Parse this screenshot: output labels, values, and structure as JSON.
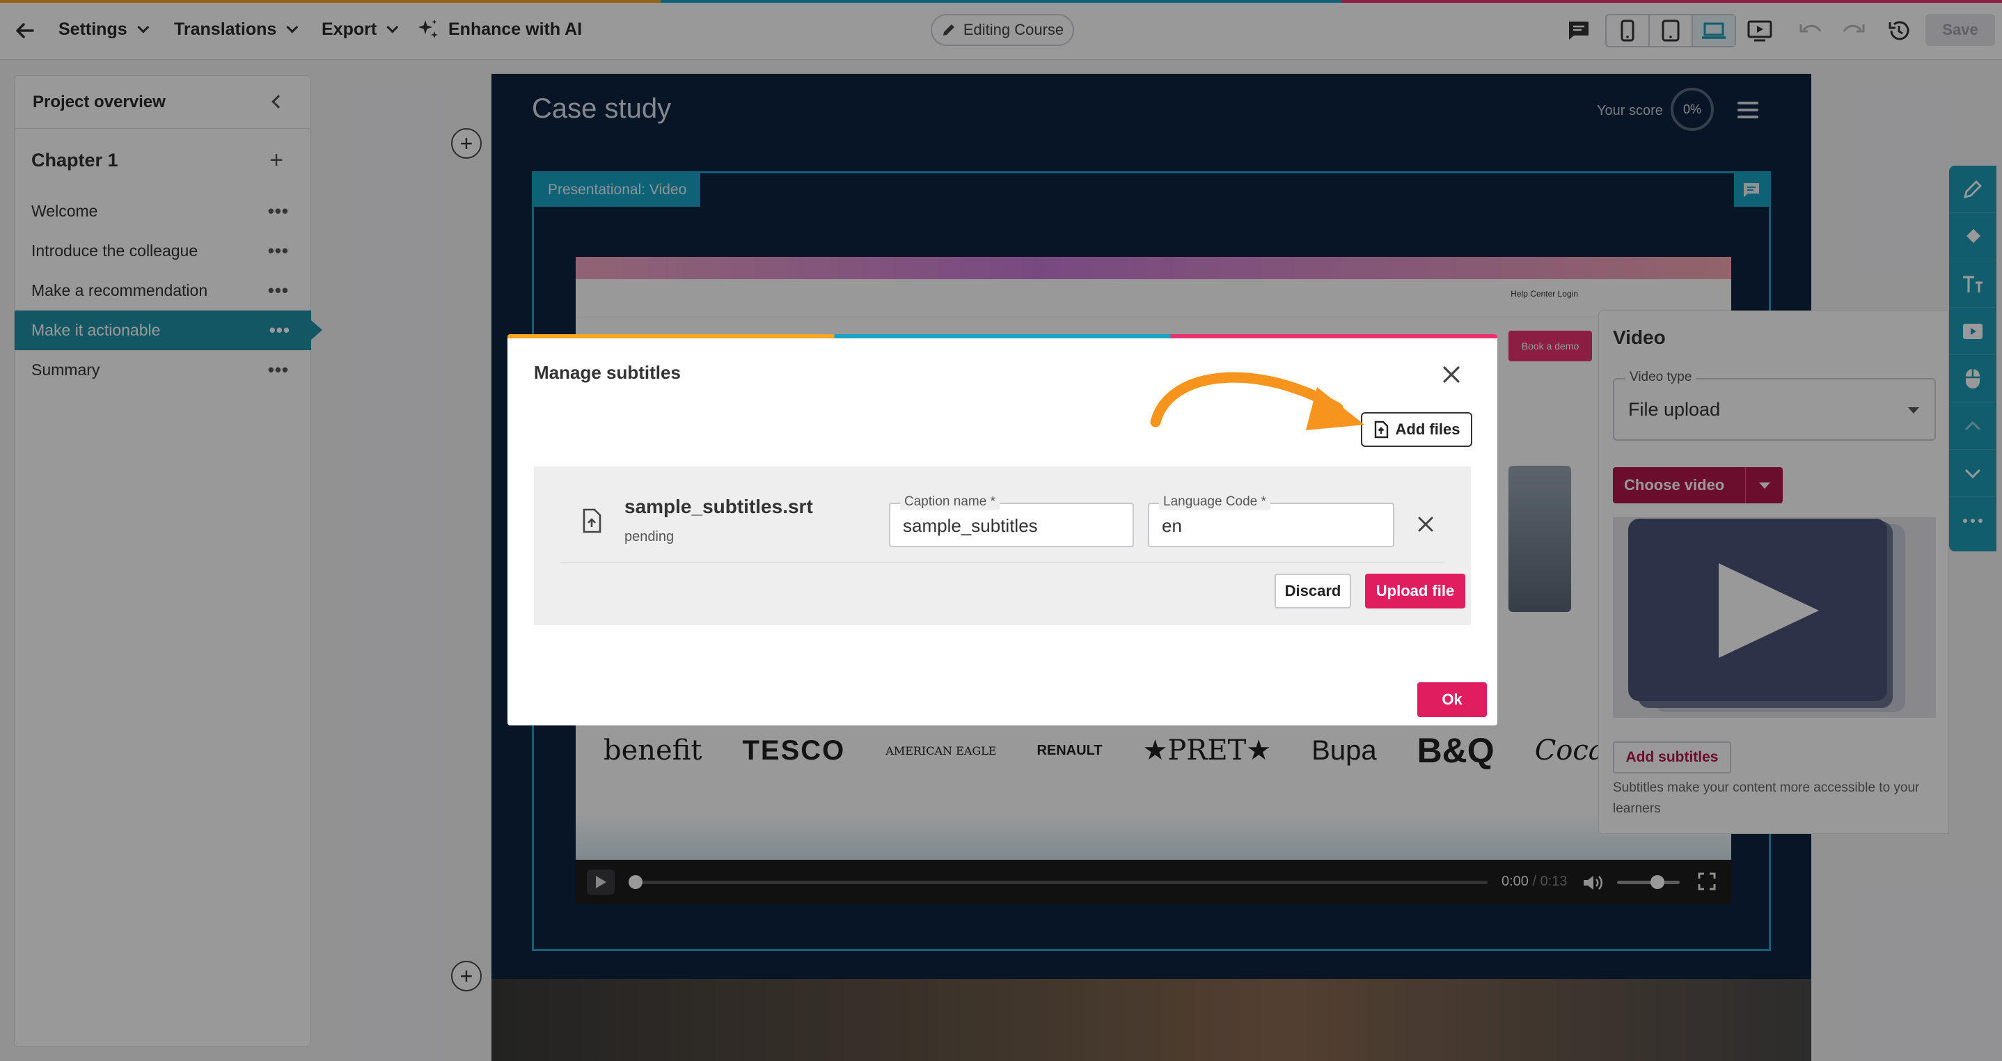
{
  "topbar": {
    "menus": [
      {
        "label": "Settings"
      },
      {
        "label": "Translations"
      },
      {
        "label": "Export"
      }
    ],
    "ai_label": "Enhance with AI",
    "mode_label": "Editing Course",
    "save_label": "Save"
  },
  "sidebar": {
    "title": "Project overview",
    "chapter": "Chapter 1",
    "items": [
      {
        "label": "Welcome",
        "active": false
      },
      {
        "label": "Introduce the colleague",
        "active": false
      },
      {
        "label": "Make a recommendation",
        "active": false
      },
      {
        "label": "Make it actionable",
        "active": true
      },
      {
        "label": "Summary",
        "active": false
      }
    ]
  },
  "course": {
    "title": "Case study",
    "score_label": "Your score",
    "score_value": "0%",
    "block_tag": "Presentational: Video",
    "video": {
      "nav_links": "Help Center   Login",
      "demo_button": "Book a demo",
      "logos": [
        "benefit",
        "TESCO",
        "AMERICAN EAGLE",
        "RENAULT",
        "★PRET★",
        "Bupa",
        "B&Q",
        "Coca-Cola"
      ],
      "time_current": "0:00",
      "time_total": " / 0:13"
    }
  },
  "props": {
    "title": "Video",
    "video_type_label": "Video type",
    "video_type_value": "File upload",
    "choose_label": "Choose video",
    "add_subtitles_label": "Add subtitles",
    "help_text": "Subtitles make your content more accessible to your learners"
  },
  "modal": {
    "title": "Manage subtitles",
    "add_files_label": "Add files",
    "file": {
      "name": "sample_subtitles.srt",
      "status": "pending",
      "caption_label": "Caption name *",
      "caption_value": "sample_subtitles",
      "lang_label": "Language Code *",
      "lang_value": "en"
    },
    "discard_label": "Discard",
    "upload_label": "Upload file",
    "ok_label": "Ok"
  },
  "colors": {
    "accent": "#1aa3c4",
    "brand_pink": "#e01d5f",
    "annotation_orange": "#f7941d"
  }
}
